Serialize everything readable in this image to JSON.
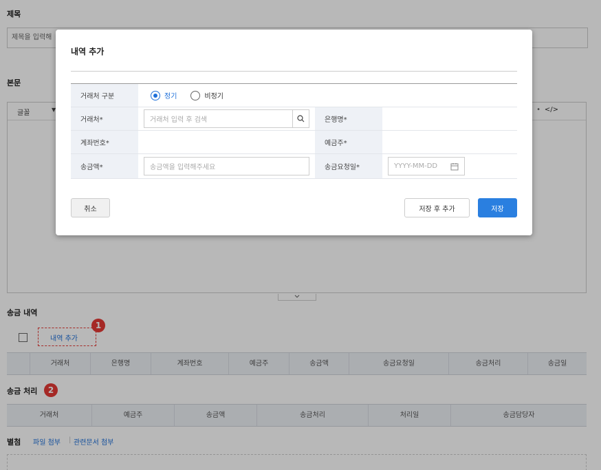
{
  "page": {
    "title_label": "제목",
    "title_placeholder": "제목을 입력해",
    "body_label": "본문",
    "font_label": "글꼴",
    "code_label": "</>",
    "toolbar_dot": "•",
    "transfer_section_label": "송금 내역",
    "add_history_link": "내역 추가",
    "badge1": "1",
    "transfer_columns": [
      "거래처",
      "은행명",
      "계좌번호",
      "예금주",
      "송금액",
      "송금요청일",
      "송금처리",
      "송금일"
    ],
    "process_section_label": "송금 처리",
    "badge2": "2",
    "process_columns": [
      "거래처",
      "예금주",
      "송금액",
      "송금처리",
      "처리일",
      "송금담당자"
    ],
    "attach_label": "별첨",
    "attach_file": "파일 첨부",
    "attach_sep": "|",
    "attach_doc": "관련문서 첨부"
  },
  "modal": {
    "title": "내역 추가",
    "vendor_type_label": "거래처 구분",
    "radio_regular": "정기",
    "radio_irregular": "비정기",
    "vendor_label": "거래처*",
    "vendor_placeholder": "거래처 입력 후 검색",
    "bank_label": "은행명*",
    "account_label": "계좌번호*",
    "holder_label": "예금주*",
    "amount_label": "송금액*",
    "amount_placeholder": "송금액을 입력해주세요",
    "request_date_label": "송금요청일*",
    "date_placeholder": "YYYY-MM-DD",
    "cancel": "취소",
    "save_and_add": "저장 후 추가",
    "save": "저장"
  },
  "colors": {
    "accent": "#2a7fe0",
    "badge": "#e53935"
  }
}
